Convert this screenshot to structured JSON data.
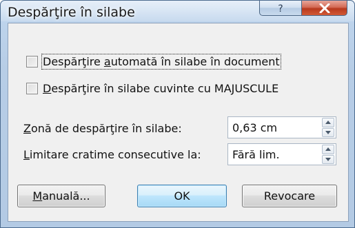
{
  "window": {
    "title": "Despărţire în silabe",
    "help_glyph": "?",
    "close_glyph": "X"
  },
  "options": {
    "auto_hyphenate": {
      "label_pre": "Despărţire ",
      "label_accel": "a",
      "label_post": "utomată în silabe în document",
      "checked": false
    },
    "hyphenate_caps": {
      "label_accel": "D",
      "label_post": "espărţire în silabe cuvinte cu MAJUSCULE",
      "checked": false
    }
  },
  "fields": {
    "hyphenation_zone": {
      "label_accel": "Z",
      "label_post": "onă de despărţire în silabe:",
      "value": "0,63 cm"
    },
    "consecutive_limit": {
      "label_accel": "L",
      "label_post": "imitare cratime consecutive la:",
      "value": "Fără lim."
    }
  },
  "buttons": {
    "manual_accel": "M",
    "manual_post": "anuală...",
    "ok": "OK",
    "cancel": "Revocare"
  },
  "colors": {
    "close_red": "#c44a2c",
    "default_button_border": "#3c7fb1",
    "frame_blue": "#b7cde6"
  }
}
